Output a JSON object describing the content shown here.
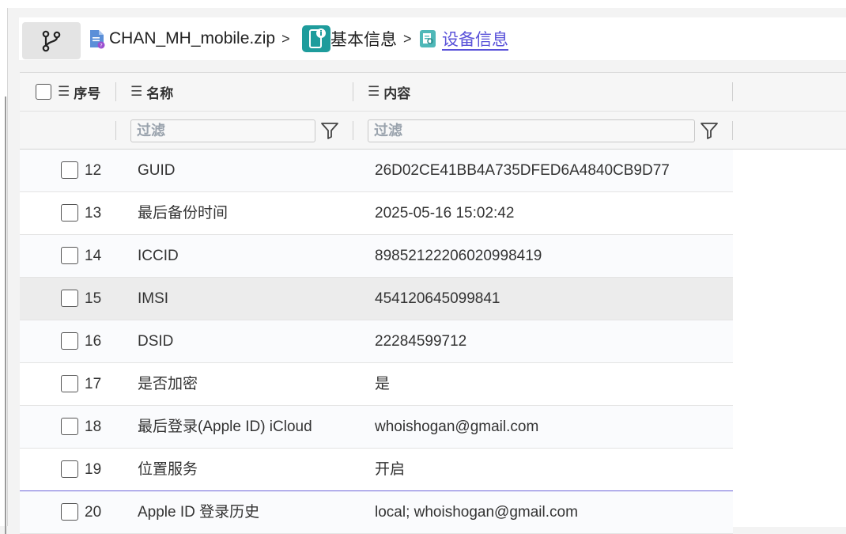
{
  "breadcrumb": {
    "file": "CHAN_MH_mobile.zip",
    "section": "基本信息",
    "current": "设备信息",
    "separator": ">"
  },
  "icons": {
    "branch": "git-branch-icon",
    "file": "zip-file-icon",
    "phone": "phone-info-icon",
    "doc": "document-icon",
    "column_menu": "list-icon",
    "filter": "filter-funnel-icon"
  },
  "colors": {
    "accent": "#5a52d9",
    "phone_badge": "#1e9c9c",
    "doc_badge": "#4fb8b8"
  },
  "table": {
    "columns": {
      "index": "序号",
      "name": "名称",
      "content": "内容",
      "menu_glyph": "☰"
    },
    "filter_placeholder_name": "过滤",
    "filter_placeholder_content": "过滤",
    "rows": [
      {
        "num": "12",
        "name": "GUID",
        "content": "26D02CE41BB4A735DFED6A4840CB9D77"
      },
      {
        "num": "13",
        "name": "最后备份时间",
        "content": "2025-05-16 15:02:42"
      },
      {
        "num": "14",
        "name": "ICCID",
        "content": "89852122206020998419"
      },
      {
        "num": "15",
        "name": "IMSI",
        "content": "454120645099841"
      },
      {
        "num": "16",
        "name": "DSID",
        "content": "22284599712"
      },
      {
        "num": "17",
        "name": "是否加密",
        "content": "是"
      },
      {
        "num": "18",
        "name": "最后登录(Apple ID) iCloud",
        "content": "whoishogan@gmail.com"
      },
      {
        "num": "19",
        "name": "位置服务",
        "content": "开启"
      },
      {
        "num": "20",
        "name": "Apple ID 登录历史",
        "content": "local; whoishogan@gmail.com"
      }
    ]
  }
}
